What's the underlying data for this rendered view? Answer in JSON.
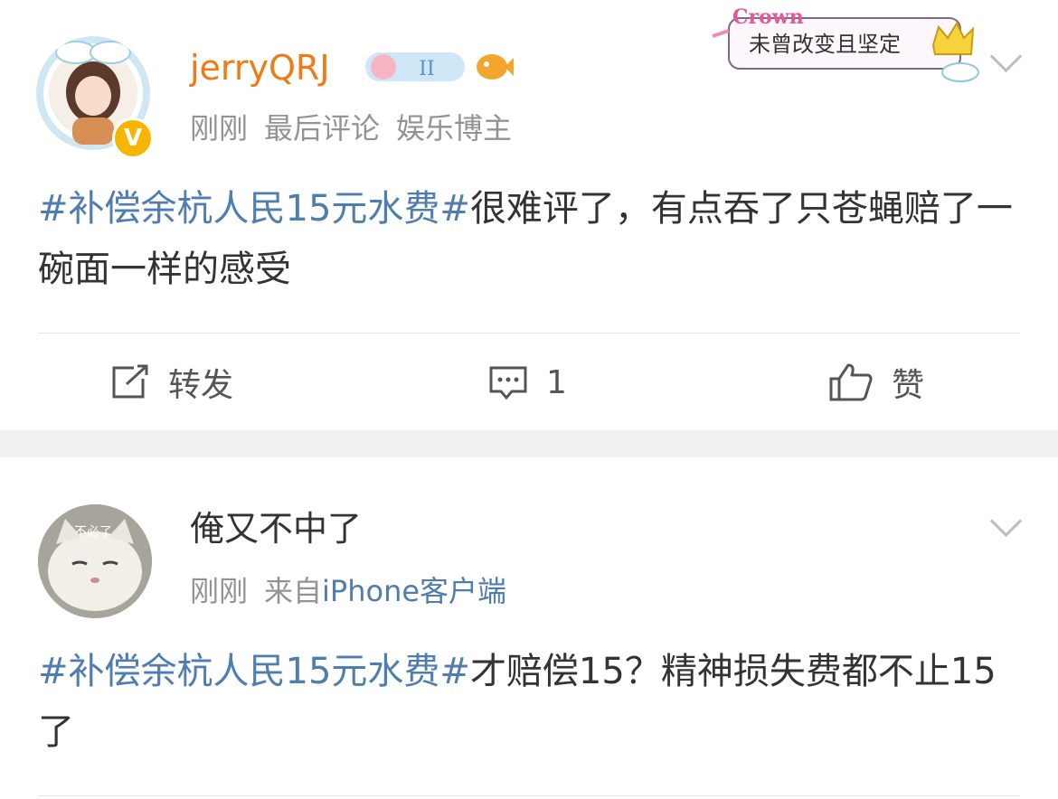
{
  "posts": [
    {
      "username": "jerryQRJ",
      "time": "刚刚",
      "meta_extra": "最后评论",
      "role": "娱乐博主",
      "verified_mark": "V",
      "badge_text": "未曾改变且坚定",
      "badge_brand": "Crown",
      "content_tag": "#补偿余杭人民15元水费#",
      "content_text": "很难评了，有点吞了只苍蝇赔了一碗面一样的感受",
      "actions": {
        "repost": "转发",
        "comment_count": "1",
        "like": "赞"
      }
    },
    {
      "username": "俺又不中了",
      "time": "刚刚",
      "source_prefix": "来自",
      "source_device": "iPhone客户端",
      "avatar_caption": "不必了",
      "content_tag": "#补偿余杭人民15元水费#",
      "content_text": "才赔偿15？精神损失费都不止15了"
    }
  ],
  "colors": {
    "accent": "#507daf",
    "username_vip": "#f07a15",
    "meta": "#939393",
    "gold": "#f7b500"
  }
}
